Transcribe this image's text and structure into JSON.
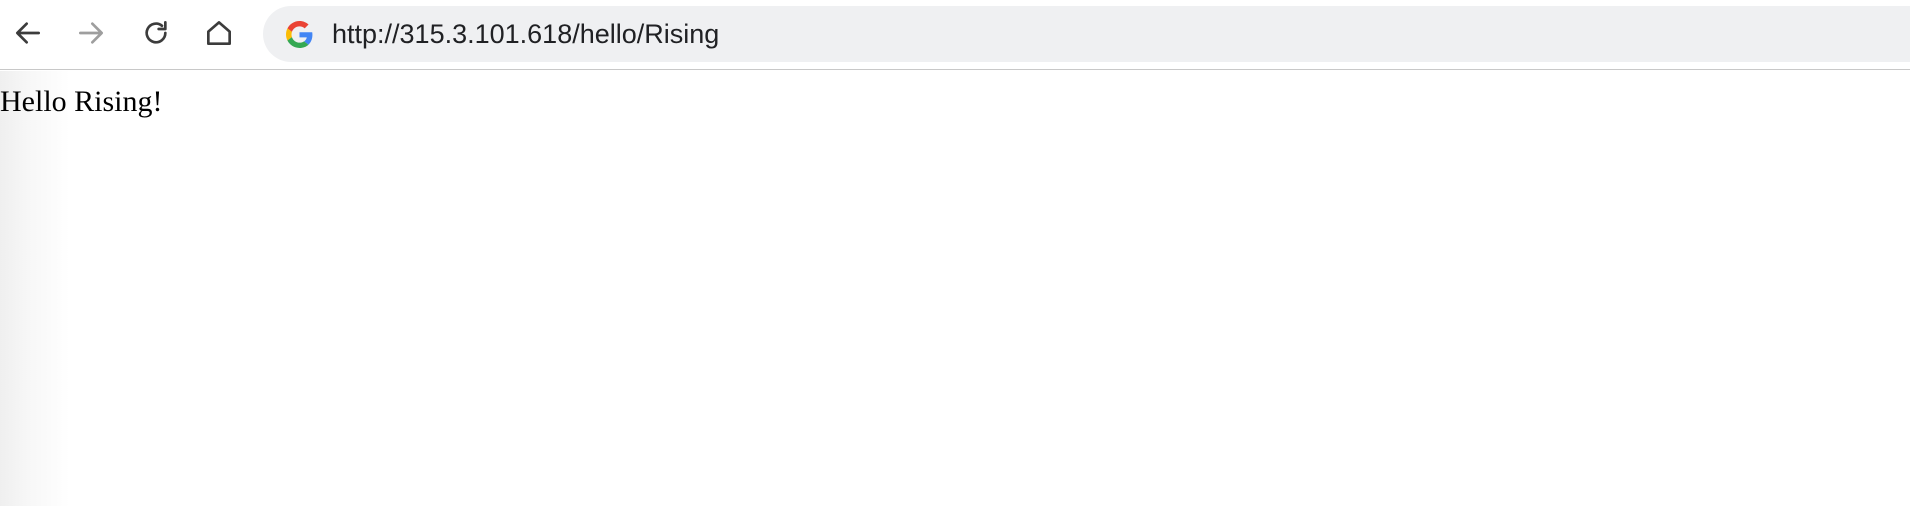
{
  "browser": {
    "nav": {
      "back_icon": "arrow-left-icon",
      "forward_icon": "arrow-right-icon",
      "reload_icon": "reload-icon",
      "home_icon": "home-icon"
    },
    "address_bar": {
      "icon": "google-g-icon",
      "url": "http://315.3.101.618/hello/Rising"
    },
    "colors": {
      "toolbar_bg": "#ffffff",
      "omnibox_bg": "#eff0f2",
      "icon_active": "#3c3c3c",
      "icon_disabled": "#9e9e9e"
    }
  },
  "page": {
    "greeting": "Hello Rising!"
  }
}
